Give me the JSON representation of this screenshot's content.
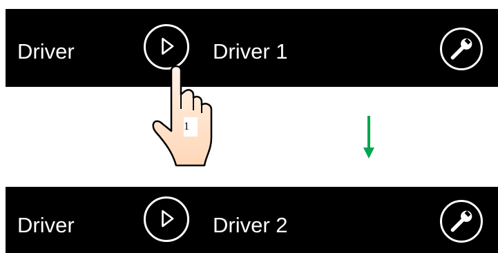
{
  "colors": {
    "bar": "#000000",
    "text": "#ffffff",
    "arrow": "#00a651"
  },
  "before": {
    "label": "Driver",
    "value": "Driver 1"
  },
  "after": {
    "label": "Driver",
    "value": "Driver 2"
  },
  "icons": {
    "play": "play-icon",
    "settings": "wrench-icon",
    "hand": "pointing-hand-icon",
    "arrow": "down-arrow-icon"
  },
  "step": "1"
}
